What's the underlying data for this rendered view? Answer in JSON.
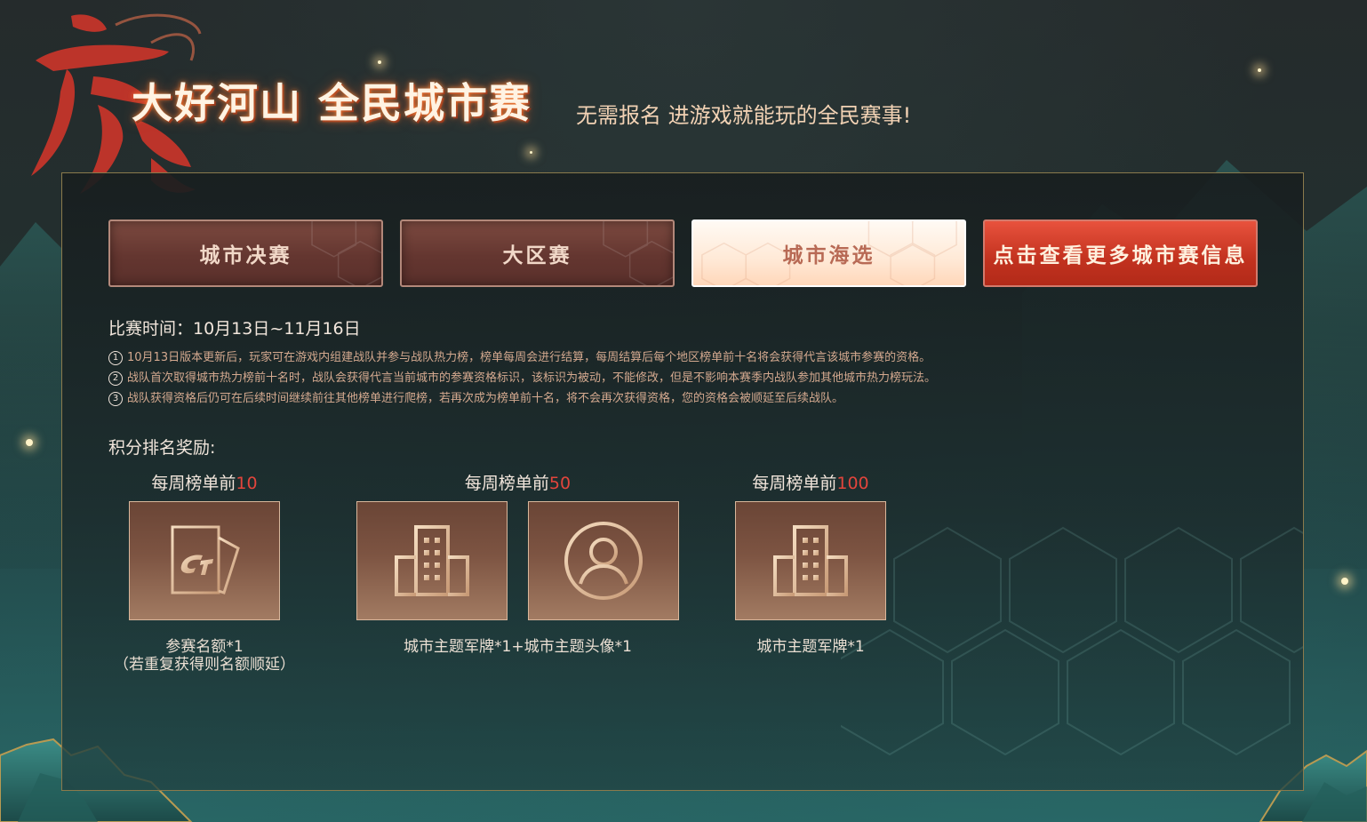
{
  "header": {
    "main_title": "大好河山 全民城市赛",
    "subtitle": "无需报名 进游戏就能玩的全民赛事!"
  },
  "tabs": [
    {
      "label": "城市决赛",
      "state": "normal"
    },
    {
      "label": "大区赛",
      "state": "normal"
    },
    {
      "label": "城市海选",
      "state": "active"
    },
    {
      "label": "点击查看更多城市赛信息",
      "state": "highlight"
    }
  ],
  "schedule": {
    "time_text": "比赛时间：10月13日~11月16日"
  },
  "rules": [
    {
      "num": "1",
      "text": "10月13日版本更新后，玩家可在游戏内组建战队并参与战队热力榜，榜单每周会进行结算，每周结算后每个地区榜单前十名将会获得代言该城市参赛的资格。"
    },
    {
      "num": "2",
      "text": "战队首次取得城市热力榜前十名时，战队会获得代言当前城市的参赛资格标识，该标识为被动，不能修改，但是不影响本赛季内战队参加其他城市热力榜玩法。"
    },
    {
      "num": "3",
      "text": "战队获得资格后仍可在后续时间继续前往其他榜单进行爬榜，若再次成为榜单前十名，将不会再次获得资格，您的资格会被顺延至后续战队。"
    }
  ],
  "rewards": {
    "title": "积分排名奖励:",
    "groups": [
      {
        "prefix": "每周榜单前",
        "rank": "10",
        "items": [
          {
            "icon": "ticket-card-icon"
          }
        ],
        "caption_lines": [
          "参赛名额*1",
          "（若重复获得则名额顺延）"
        ]
      },
      {
        "prefix": "每周榜单前",
        "rank": "50",
        "items": [
          {
            "icon": "building-icon"
          },
          {
            "icon": "avatar-icon"
          }
        ],
        "caption_lines": [
          "城市主题军牌*1+城市主题头像*1"
        ]
      },
      {
        "prefix": "每周榜单前",
        "rank": "100",
        "items": [
          {
            "icon": "building-icon"
          }
        ],
        "caption_lines": [
          "城市主题军牌*1"
        ]
      }
    ]
  },
  "colors": {
    "accent_red": "#e2453c",
    "panel_border": "#8a7a4c",
    "tab_active_bg": "#ffe9d6",
    "tab_highlight_bg": "#c2321f"
  }
}
